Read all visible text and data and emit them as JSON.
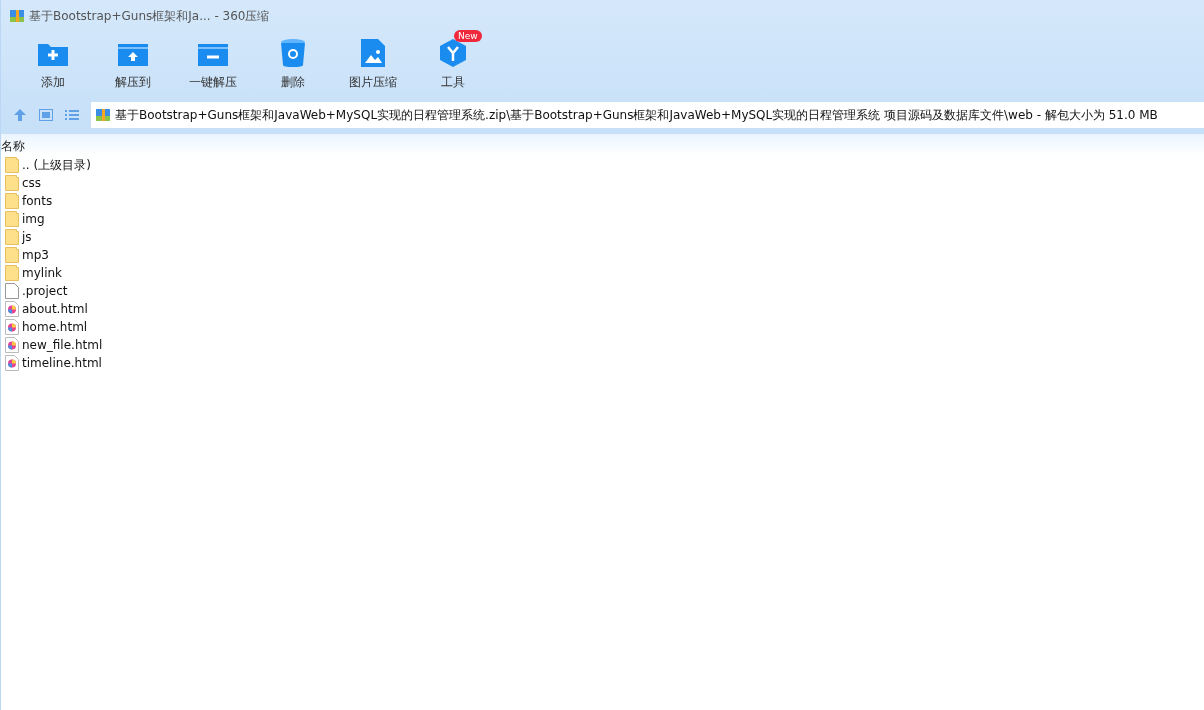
{
  "window": {
    "title": "基于Bootstrap+Guns框架和Ja... - 360压缩"
  },
  "toolbar": [
    {
      "kind": "add",
      "label": "添加"
    },
    {
      "kind": "extract",
      "label": "解压到"
    },
    {
      "kind": "oneclick",
      "label": "一键解压"
    },
    {
      "kind": "delete",
      "label": "删除"
    },
    {
      "kind": "image",
      "label": "图片压缩"
    },
    {
      "kind": "tools",
      "label": "工具",
      "badge": "New"
    }
  ],
  "address": {
    "path": "基于Bootstrap+Guns框架和JavaWeb+MySQL实现的日程管理系统.zip\\基于Bootstrap+Guns框架和JavaWeb+MySQL实现的日程管理系统 项目源码及数据库文件\\web - 解包大小为 51.0 MB"
  },
  "table": {
    "columns": [
      "名称"
    ],
    "rows": [
      {
        "kind": "folder",
        "name": ".. (上级目录)"
      },
      {
        "kind": "folder",
        "name": "css"
      },
      {
        "kind": "folder",
        "name": "fonts"
      },
      {
        "kind": "folder",
        "name": "img"
      },
      {
        "kind": "folder",
        "name": "js"
      },
      {
        "kind": "folder",
        "name": "mp3"
      },
      {
        "kind": "folder",
        "name": "mylink"
      },
      {
        "kind": "file",
        "name": ".project"
      },
      {
        "kind": "html",
        "name": "about.html"
      },
      {
        "kind": "html",
        "name": "home.html"
      },
      {
        "kind": "html",
        "name": "new_file.html"
      },
      {
        "kind": "html",
        "name": "timeline.html"
      }
    ]
  }
}
